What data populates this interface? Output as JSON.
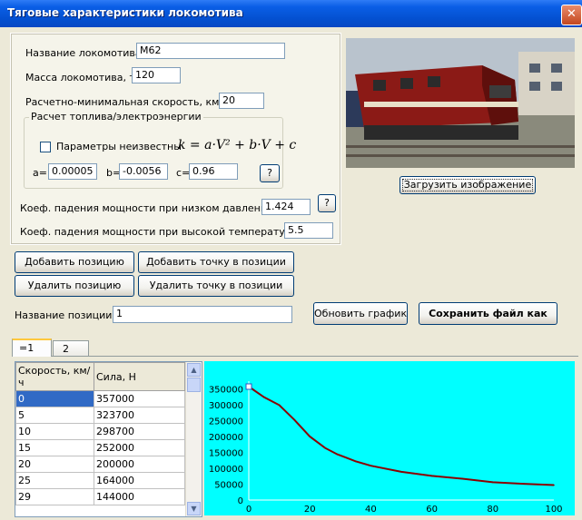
{
  "window": {
    "title": "Тяговые характеристики локомотива",
    "close_glyph": "✕"
  },
  "form": {
    "name_label": "Название локомотива",
    "name_value": "М62",
    "mass_label": "Масса локомотива, т",
    "mass_value": "120",
    "speed_label": "Расчетно-минимальная скорость, км/ч",
    "speed_value": "20",
    "fuel_group_label": "Расчет топлива/электроэнергии",
    "unknown_params_label": "Параметры неизвестны",
    "formula": "k = a·V² + b·V + c",
    "a_label": "a=",
    "a_value": "0.00005",
    "b_label": "b=",
    "b_value": "-0.0056",
    "c_label": "c=",
    "c_value": "0.96",
    "help_label": "?",
    "low_pressure_label": "Коеф. падения мощности при низком давлении",
    "low_pressure_value": "1.424",
    "high_temp_label": "Коеф. падения мощности при высокой температуре",
    "high_temp_value": "5.5"
  },
  "image_panel": {
    "load_button": "Загрузить изображение"
  },
  "buttons": {
    "add_position": "Добавить позицию",
    "delete_position": "Удалить позицию",
    "add_point": "Добавить точку в позиции",
    "delete_point": "Удалить точку в позиции",
    "refresh_chart": "Обновить график",
    "save_as": "Сохранить файл как"
  },
  "position": {
    "label": "Название позиции",
    "value": "1"
  },
  "tabs": [
    {
      "label": "=1"
    },
    {
      "label": "2"
    }
  ],
  "table": {
    "headers": [
      "Скорость, км/ч",
      "Сила, Н"
    ],
    "rows": [
      [
        "0",
        "357000"
      ],
      [
        "5",
        "323700"
      ],
      [
        "10",
        "298700"
      ],
      [
        "15",
        "252000"
      ],
      [
        "20",
        "200000"
      ],
      [
        "25",
        "164000"
      ],
      [
        "29",
        "144000"
      ]
    ]
  },
  "chart_data": {
    "type": "line",
    "background": "#00ffff",
    "line_color": "#8b0000",
    "x": [
      0,
      5,
      10,
      15,
      20,
      25,
      29,
      35,
      40,
      50,
      60,
      70,
      80,
      90,
      100
    ],
    "y": [
      357000,
      323700,
      298700,
      252000,
      200000,
      164000,
      144000,
      122000,
      108000,
      89000,
      76000,
      67000,
      56000,
      51000,
      47000
    ],
    "xticks": [
      "0",
      "20",
      "40",
      "60",
      "80",
      "100"
    ],
    "yticks": [
      "0",
      "50000",
      "100000",
      "150000",
      "200000",
      "250000",
      "300000",
      "350000"
    ],
    "xlim": [
      0,
      100
    ],
    "ylim": [
      0,
      357000
    ]
  }
}
